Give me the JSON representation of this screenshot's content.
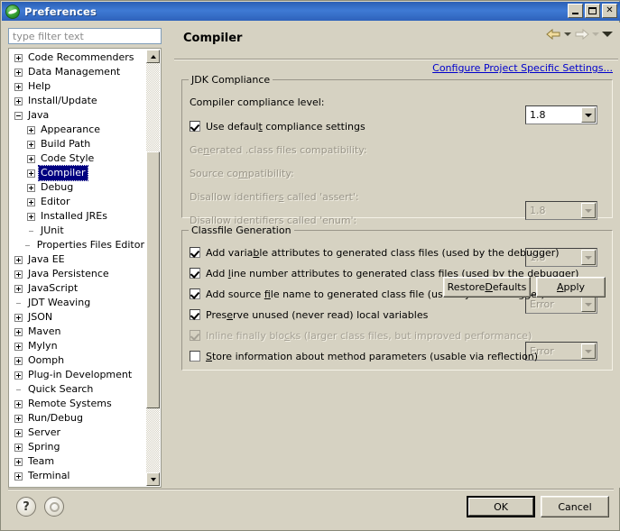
{
  "window": {
    "title": "Preferences",
    "icon": "eclipse-icon",
    "controls": {
      "minimize": "minimize-icon",
      "maximize": "maximize-icon",
      "close": "close-icon"
    }
  },
  "sidebar": {
    "filter": {
      "placeholder": "type filter text",
      "value": ""
    },
    "items": [
      {
        "label": "Code Recommenders",
        "indent": 0,
        "expander": "plus"
      },
      {
        "label": "Data Management",
        "indent": 0,
        "expander": "plus"
      },
      {
        "label": "Help",
        "indent": 0,
        "expander": "plus"
      },
      {
        "label": "Install/Update",
        "indent": 0,
        "expander": "plus"
      },
      {
        "label": "Java",
        "indent": 0,
        "expander": "minus"
      },
      {
        "label": "Appearance",
        "indent": 1,
        "expander": "plus"
      },
      {
        "label": "Build Path",
        "indent": 1,
        "expander": "plus"
      },
      {
        "label": "Code Style",
        "indent": 1,
        "expander": "plus"
      },
      {
        "label": "Compiler",
        "indent": 1,
        "expander": "plus",
        "selected": true
      },
      {
        "label": "Debug",
        "indent": 1,
        "expander": "plus"
      },
      {
        "label": "Editor",
        "indent": 1,
        "expander": "plus"
      },
      {
        "label": "Installed JREs",
        "indent": 1,
        "expander": "plus"
      },
      {
        "label": "JUnit",
        "indent": 1,
        "expander": "none"
      },
      {
        "label": "Properties Files Editor",
        "indent": 1,
        "expander": "none"
      },
      {
        "label": "Java EE",
        "indent": 0,
        "expander": "plus"
      },
      {
        "label": "Java Persistence",
        "indent": 0,
        "expander": "plus"
      },
      {
        "label": "JavaScript",
        "indent": 0,
        "expander": "plus"
      },
      {
        "label": "JDT Weaving",
        "indent": 0,
        "expander": "none"
      },
      {
        "label": "JSON",
        "indent": 0,
        "expander": "plus"
      },
      {
        "label": "Maven",
        "indent": 0,
        "expander": "plus"
      },
      {
        "label": "Mylyn",
        "indent": 0,
        "expander": "plus"
      },
      {
        "label": "Oomph",
        "indent": 0,
        "expander": "plus"
      },
      {
        "label": "Plug-in Development",
        "indent": 0,
        "expander": "plus"
      },
      {
        "label": "Quick Search",
        "indent": 0,
        "expander": "none"
      },
      {
        "label": "Remote Systems",
        "indent": 0,
        "expander": "plus"
      },
      {
        "label": "Run/Debug",
        "indent": 0,
        "expander": "plus"
      },
      {
        "label": "Server",
        "indent": 0,
        "expander": "plus"
      },
      {
        "label": "Spring",
        "indent": 0,
        "expander": "plus"
      },
      {
        "label": "Team",
        "indent": 0,
        "expander": "plus"
      },
      {
        "label": "Terminal",
        "indent": 0,
        "expander": "plus"
      }
    ]
  },
  "page": {
    "title": "Compiler",
    "configure_link": "Configure Project Specific Settings...",
    "nav": {
      "back": "back-arrow-icon",
      "back_menu": "back-dropdown-icon",
      "forward": "forward-arrow-icon",
      "forward_menu": "forward-dropdown-icon",
      "view_menu": "view-menu-icon"
    },
    "jdk_compliance": {
      "legend": "JDK Compliance",
      "compliance_level": {
        "label": "Compiler compliance level:",
        "value": "1.8",
        "disabled": false
      },
      "use_default": {
        "label_pre": "Use defaul",
        "label_mnemonic": "t",
        "label_post": " compliance settings",
        "checked": true,
        "disabled": false
      },
      "rows": [
        {
          "label_pre": "Ge",
          "label_mnemonic": "n",
          "label_post": "erated .class files compatibility:",
          "value": "1.8",
          "disabled": true
        },
        {
          "label_pre": "Source co",
          "label_mnemonic": "m",
          "label_post": "patibility:",
          "value": "1.8",
          "disabled": true
        },
        {
          "label_pre": "Disallow identifier",
          "label_mnemonic": "s",
          "label_post": " called 'assert':",
          "value": "Error",
          "disabled": true
        },
        {
          "label_pre": "Disallo",
          "label_mnemonic": "w",
          "label_post": " identifiers called 'enum':",
          "value": "Error",
          "disabled": true
        }
      ]
    },
    "classfile_generation": {
      "legend": "Classfile Generation",
      "options": [
        {
          "label_pre": "Add varia",
          "label_mnemonic": "b",
          "label_post": "le attributes to generated class files (used by the debugger)",
          "checked": true,
          "disabled": false
        },
        {
          "label_pre": "Add ",
          "label_mnemonic": "l",
          "label_post": "ine number attributes to generated class files (used by the debugger)",
          "checked": true,
          "disabled": false
        },
        {
          "label_pre": "Add source ",
          "label_mnemonic": "f",
          "label_post": "ile name to generated class file (used by the debugger)",
          "checked": true,
          "disabled": false
        },
        {
          "label_pre": "Pres",
          "label_mnemonic": "e",
          "label_post": "rve unused (never read) local variables",
          "checked": true,
          "disabled": false
        },
        {
          "label_pre": "Inline finally blo",
          "label_mnemonic": "c",
          "label_post": "ks (larger class files, but improved performance)",
          "checked": true,
          "disabled": true
        },
        {
          "label_pre": "",
          "label_mnemonic": "S",
          "label_post": "tore information about method parameters (usable via reflection)",
          "checked": false,
          "disabled": false
        }
      ]
    },
    "buttons": {
      "restore_defaults_pre": "Restore ",
      "restore_defaults_mnemonic": "D",
      "restore_defaults_post": "efaults",
      "apply_pre": "",
      "apply_mnemonic": "A",
      "apply_post": "pply"
    }
  },
  "footer": {
    "help_icon": "help-question-icon",
    "secondary_icon": "disabled-circle-icon",
    "ok": "OK",
    "cancel": "Cancel"
  },
  "colors": {
    "titlebar_start": "#2b5fb5",
    "titlebar_end": "#2e62bb",
    "dialog_bg": "#d6d2c2",
    "selection": "#000080",
    "link": "#0000cc",
    "disabled_text": "#9a968a"
  }
}
